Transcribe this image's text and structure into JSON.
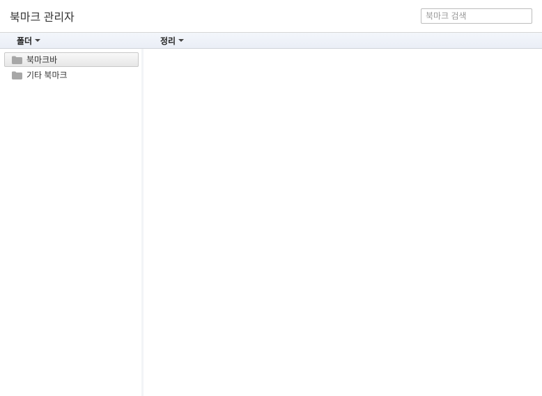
{
  "header": {
    "title": "북마크 관리자",
    "search_placeholder": "북마크 검색"
  },
  "toolbar": {
    "folder_label": "폴더",
    "organize_label": "정리"
  },
  "sidebar": {
    "folders": [
      {
        "label": "북마크바",
        "selected": true
      },
      {
        "label": "기타 북마크",
        "selected": false
      }
    ]
  }
}
